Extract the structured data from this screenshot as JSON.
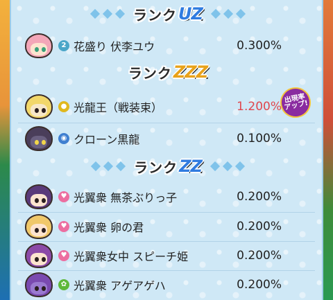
{
  "sections": [
    {
      "rank_word": "ランク",
      "rank_code": "UZ",
      "code_color": "#2f7be0",
      "entries": [
        {
          "name": "花盛り 伏李ユウ",
          "percent": "0.300%",
          "tribe_icon": "tribe-spiral-icon",
          "tribe_color": "#4aa6c8",
          "tribe_glyph": "2",
          "avatar_color": "#f3a6b8",
          "highlight": false
        }
      ]
    },
    {
      "rank_word": "ランク",
      "rank_code": "ZZZ",
      "code_color": "#e8a21a",
      "entries": [
        {
          "name": "光龍王（戦装束）",
          "percent": "1.200%",
          "tribe_icon": "tribe-bulb-icon",
          "tribe_color": "#e0b81e",
          "tribe_glyph": "●",
          "avatar_color": "#f2d76a",
          "highlight": true,
          "badge": "出現率\nアップ!"
        },
        {
          "name": "クローン黒龍",
          "percent": "0.100%",
          "tribe_icon": "tribe-frog-icon",
          "tribe_color": "#3f7fd0",
          "tribe_glyph": "◉",
          "avatar_color": "#4a3e5a",
          "highlight": false
        }
      ]
    },
    {
      "rank_word": "ランク",
      "rank_code": "ZZ",
      "code_color": "#2f7be0",
      "entries": [
        {
          "name": "光翼衆 無茶ぶりっ子",
          "percent": "0.200%",
          "tribe_icon": "tribe-heart-icon",
          "tribe_color": "#ec6ea0",
          "tribe_glyph": "♥",
          "avatar_color": "#5a3a7a",
          "highlight": false
        },
        {
          "name": "光翼衆 卵の君",
          "percent": "0.200%",
          "tribe_icon": "tribe-heart-icon",
          "tribe_color": "#ec6ea0",
          "tribe_glyph": "♥",
          "avatar_color": "#f0c86a",
          "highlight": false
        },
        {
          "name": "光翼衆女中 スピーチ姫",
          "percent": "0.200%",
          "tribe_icon": "tribe-heart-icon",
          "tribe_color": "#ec6ea0",
          "tribe_glyph": "♥",
          "avatar_color": "#8c4aa8",
          "highlight": false
        },
        {
          "name": "光翼衆 アゲアゲハ",
          "percent": "0.200%",
          "tribe_icon": "tribe-clover-icon",
          "tribe_color": "#5fb83a",
          "tribe_glyph": "✿",
          "avatar_color": "#7a4ab0",
          "highlight": false
        }
      ]
    }
  ]
}
